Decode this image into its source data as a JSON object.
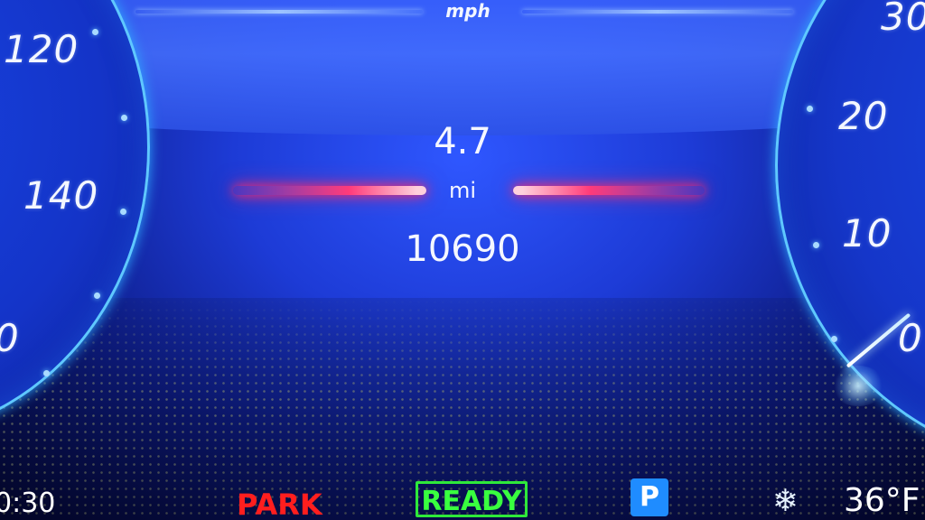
{
  "speedometer": {
    "unit": "mph",
    "left_scale": [
      "120",
      "140",
      "0"
    ],
    "right_scale": [
      "30",
      "20",
      "10",
      "0"
    ]
  },
  "trip": {
    "distance": "4.7",
    "unit": "mi",
    "odometer": "10690"
  },
  "status_bar": {
    "clock": "0:30",
    "gear": "PARK",
    "ready": "READY",
    "parking_icon": "P",
    "frost_icon": "❄",
    "temperature": "36°F"
  },
  "colors": {
    "background": "#1d3bd6",
    "gauge_ring": "#5fc8ff",
    "gear_park": "#ff1e1e",
    "ready": "#39ff3f",
    "parking": "#1f8cff",
    "trip_bar": "#ff3b7a"
  },
  "icons": {
    "parking": "parking-icon",
    "frost": "snowflake-icon"
  }
}
